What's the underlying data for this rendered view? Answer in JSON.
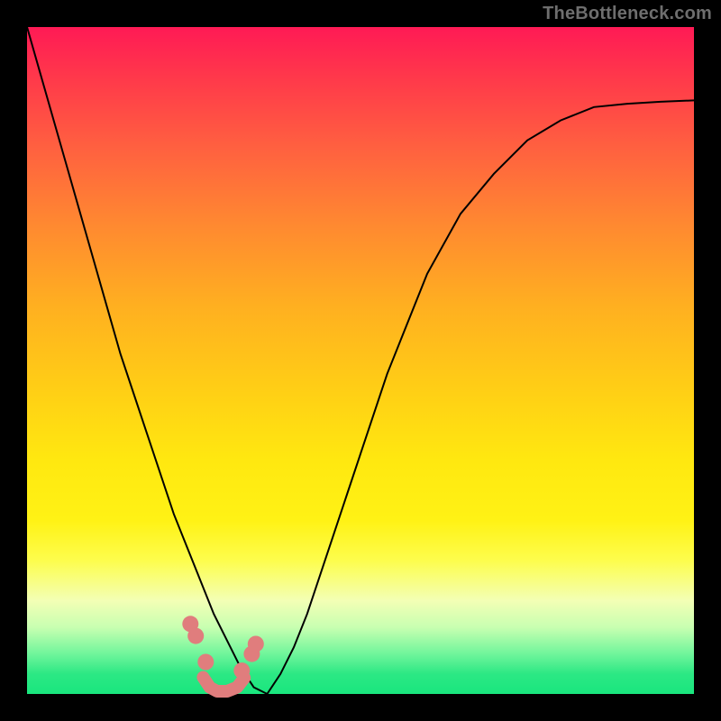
{
  "watermark": "TheBottleneck.com",
  "colors": {
    "background": "#000000",
    "gradient_top": "#ff1a55",
    "gradient_mid": "#ffe810",
    "gradient_bottom": "#19e67e",
    "curve": "#000000",
    "marker": "#e07d7d"
  },
  "chart_data": {
    "type": "line",
    "title": "",
    "xlabel": "",
    "ylabel": "",
    "x": [
      0.0,
      0.02,
      0.04,
      0.06,
      0.08,
      0.1,
      0.12,
      0.14,
      0.16,
      0.18,
      0.2,
      0.22,
      0.24,
      0.26,
      0.28,
      0.3,
      0.32,
      0.34,
      0.36,
      0.38,
      0.4,
      0.42,
      0.44,
      0.46,
      0.48,
      0.5,
      0.52,
      0.54,
      0.56,
      0.58,
      0.6,
      0.65,
      0.7,
      0.75,
      0.8,
      0.85,
      0.9,
      0.95,
      1.0
    ],
    "values": [
      1.0,
      0.93,
      0.86,
      0.79,
      0.72,
      0.65,
      0.58,
      0.51,
      0.45,
      0.39,
      0.33,
      0.27,
      0.22,
      0.17,
      0.12,
      0.08,
      0.04,
      0.01,
      0.0,
      0.03,
      0.07,
      0.12,
      0.18,
      0.24,
      0.3,
      0.36,
      0.42,
      0.48,
      0.53,
      0.58,
      0.63,
      0.72,
      0.78,
      0.83,
      0.86,
      0.88,
      0.885,
      0.888,
      0.89
    ],
    "xlim": [
      0,
      1
    ],
    "ylim": [
      0,
      1
    ],
    "minimum": {
      "x": 0.29,
      "y": 0.0
    },
    "markers": [
      {
        "x": 0.245,
        "y": 0.105
      },
      {
        "x": 0.253,
        "y": 0.087
      },
      {
        "x": 0.268,
        "y": 0.048
      },
      {
        "x": 0.322,
        "y": 0.035
      },
      {
        "x": 0.337,
        "y": 0.06
      },
      {
        "x": 0.343,
        "y": 0.075
      }
    ],
    "valley_path": [
      {
        "x": 0.264,
        "y": 0.025
      },
      {
        "x": 0.274,
        "y": 0.01
      },
      {
        "x": 0.285,
        "y": 0.004
      },
      {
        "x": 0.3,
        "y": 0.004
      },
      {
        "x": 0.315,
        "y": 0.01
      },
      {
        "x": 0.326,
        "y": 0.024
      }
    ]
  }
}
